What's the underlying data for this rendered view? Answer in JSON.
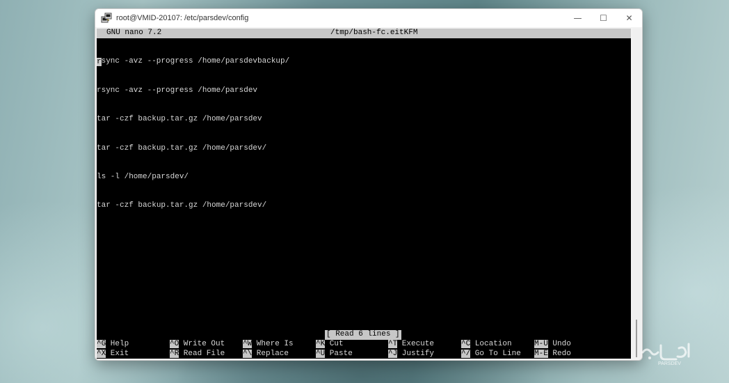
{
  "window": {
    "title": "root@VMID-20107: /etc/parsdev/config",
    "controls": {
      "minimize": "—",
      "maximize": "☐",
      "close": "✕"
    }
  },
  "nano": {
    "version_label": "GNU nano 7.2",
    "file_name": "/tmp/bash-fc.eitKFM",
    "cursor_char": "r",
    "lines": [
      "sync -avz --progress /home/parsdevbackup/",
      "rsync -avz --progress /home/parsdev",
      "tar -czf backup.tar.gz /home/parsdev",
      "tar -czf backup.tar.gz /home/parsdev/",
      "ls -l /home/parsdev/",
      "tar -czf backup.tar.gz /home/parsdev/"
    ],
    "status_message": "[ Read 6 lines ]",
    "shortcuts_row1": [
      {
        "key": "^G",
        "label": " Help"
      },
      {
        "key": "^O",
        "label": " Write Out"
      },
      {
        "key": "^W",
        "label": " Where Is"
      },
      {
        "key": "^K",
        "label": " Cut"
      },
      {
        "key": "^T",
        "label": " Execute"
      },
      {
        "key": "^C",
        "label": " Location"
      },
      {
        "key": "M-U",
        "label": " Undo"
      }
    ],
    "shortcuts_row2": [
      {
        "key": "^X",
        "label": " Exit"
      },
      {
        "key": "^R",
        "label": " Read File"
      },
      {
        "key": "^\\",
        "label": " Replace"
      },
      {
        "key": "^U",
        "label": " Paste"
      },
      {
        "key": "^J",
        "label": " Justify"
      },
      {
        "key": "^/",
        "label": " Go To Line"
      },
      {
        "key": "M-E",
        "label": " Redo"
      }
    ]
  },
  "watermark": {
    "brand": "PARSDEV"
  },
  "colors": {
    "terminal_bg": "#000000",
    "terminal_fg": "#d8d8d8",
    "inverse_bg": "#c7c7c7"
  }
}
